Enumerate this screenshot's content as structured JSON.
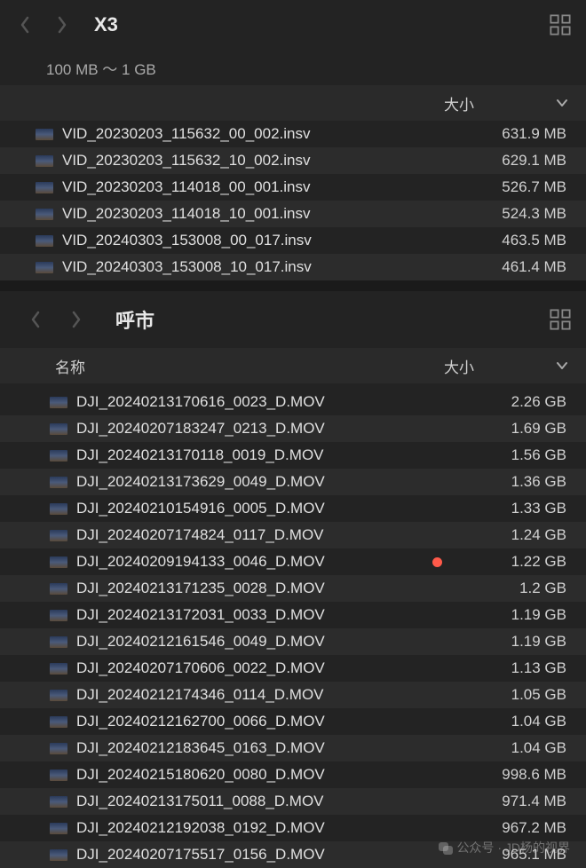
{
  "panel1": {
    "title": "X3",
    "filter_label": "100 MB ～ 1 GB",
    "header": {
      "size_label": "大小"
    },
    "files": [
      {
        "name": "VID_20230203_115632_00_002.insv",
        "size": "631.9 MB"
      },
      {
        "name": "VID_20230203_115632_10_002.insv",
        "size": "629.1 MB"
      },
      {
        "name": "VID_20230203_114018_00_001.insv",
        "size": "526.7 MB"
      },
      {
        "name": "VID_20230203_114018_10_001.insv",
        "size": "524.3 MB"
      },
      {
        "name": "VID_20240303_153008_00_017.insv",
        "size": "463.5 MB"
      },
      {
        "name": "VID_20240303_153008_10_017.insv",
        "size": "461.4 MB"
      }
    ]
  },
  "panel2": {
    "title": "呼市",
    "header": {
      "name_label": "名称",
      "size_label": "大小"
    },
    "files": [
      {
        "name": "DJI_20240213170616_0023_D.MOV",
        "size": "2.26 GB"
      },
      {
        "name": "DJI_20240207183247_0213_D.MOV",
        "size": "1.69 GB"
      },
      {
        "name": "DJI_20240213170118_0019_D.MOV",
        "size": "1.56 GB"
      },
      {
        "name": "DJI_20240213173629_0049_D.MOV",
        "size": "1.36 GB"
      },
      {
        "name": "DJI_20240210154916_0005_D.MOV",
        "size": "1.33 GB"
      },
      {
        "name": "DJI_20240207174824_0117_D.MOV",
        "size": "1.24 GB"
      },
      {
        "name": "DJI_20240209194133_0046_D.MOV",
        "size": "1.22 GB",
        "tag": "red"
      },
      {
        "name": "DJI_20240213171235_0028_D.MOV",
        "size": "1.2 GB"
      },
      {
        "name": "DJI_20240213172031_0033_D.MOV",
        "size": "1.19 GB"
      },
      {
        "name": "DJI_20240212161546_0049_D.MOV",
        "size": "1.19 GB"
      },
      {
        "name": "DJI_20240207170606_0022_D.MOV",
        "size": "1.13 GB"
      },
      {
        "name": "DJI_20240212174346_0114_D.MOV",
        "size": "1.05 GB"
      },
      {
        "name": "DJI_20240212162700_0066_D.MOV",
        "size": "1.04 GB"
      },
      {
        "name": "DJI_20240212183645_0163_D.MOV",
        "size": "1.04 GB"
      },
      {
        "name": "DJI_20240215180620_0080_D.MOV",
        "size": "998.6 MB"
      },
      {
        "name": "DJI_20240213175011_0088_D.MOV",
        "size": "971.4 MB"
      },
      {
        "name": "DJI_20240212192038_0192_D.MOV",
        "size": "967.2 MB"
      },
      {
        "name": "DJI_20240207175517_0156_D.MOV",
        "size": "965.1 MB"
      }
    ]
  },
  "watermark": "公众号 · JD杨的视界"
}
